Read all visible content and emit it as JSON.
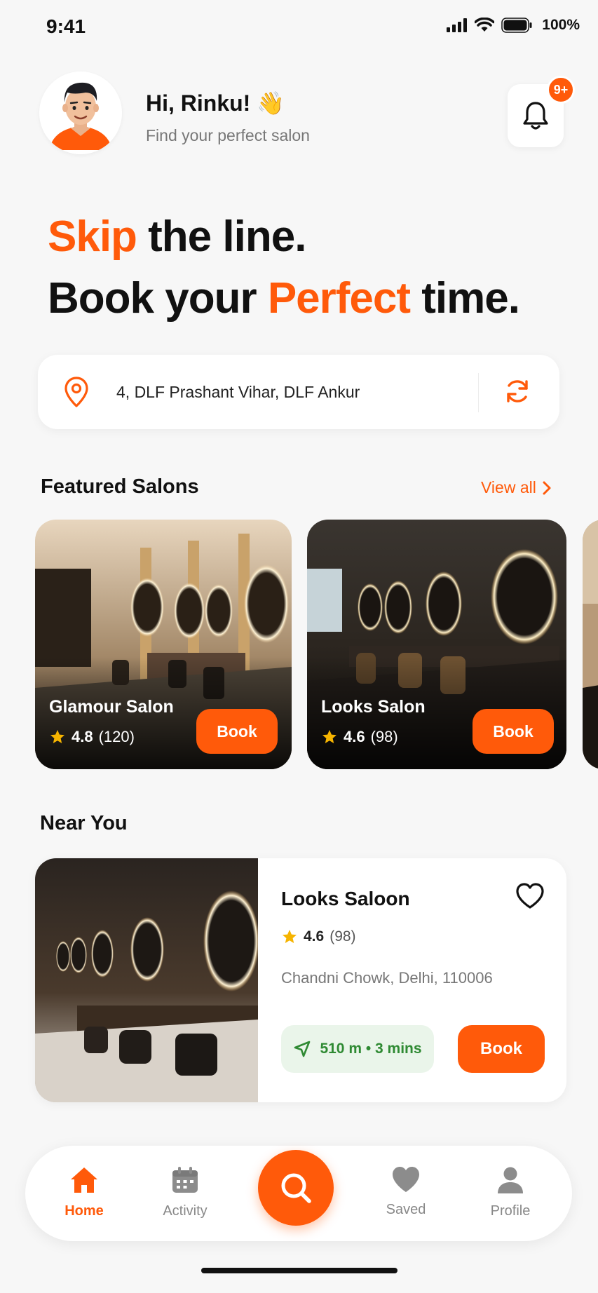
{
  "status_bar": {
    "time": "9:41",
    "battery": "100%"
  },
  "header": {
    "greeting": "Hi, Rinku! 👋",
    "subtitle": "Find your perfect salon",
    "notification_badge": "9+"
  },
  "hero": {
    "line1_accent": "Skip",
    "line1_rest": " the line.",
    "line2_start": "Book your ",
    "line2_accent": "Perfect",
    "line2_end": " time."
  },
  "location": {
    "address": "4, DLF Prashant Vihar, DLF Ankur"
  },
  "featured": {
    "title": "Featured Salons",
    "view_all": "View all",
    "items": [
      {
        "name": "Glamour Salon",
        "rating": "4.8",
        "reviews": "(120)",
        "book_label": "Book"
      },
      {
        "name": "Looks Salon",
        "rating": "4.6",
        "reviews": "(98)",
        "book_label": "Book"
      }
    ]
  },
  "near_you": {
    "title": "Near You",
    "item": {
      "name": "Looks Saloon",
      "rating": "4.6",
      "reviews": "(98)",
      "address": "Chandni Chowk, Delhi, 110006",
      "distance": "510 m • 3 mins",
      "book_label": "Book"
    }
  },
  "bottom_nav": {
    "items": [
      {
        "label": "Home",
        "icon": "home-icon",
        "active": true
      },
      {
        "label": "Activity",
        "icon": "calendar-icon",
        "active": false
      },
      {
        "label": "Saved",
        "icon": "heart-icon",
        "active": false
      },
      {
        "label": "Profile",
        "icon": "user-icon",
        "active": false
      }
    ],
    "center_icon": "search-icon"
  },
  "colors": {
    "accent": "#ff5a0a",
    "background": "#f7f7f7",
    "distance_green": "#2f8a33"
  }
}
